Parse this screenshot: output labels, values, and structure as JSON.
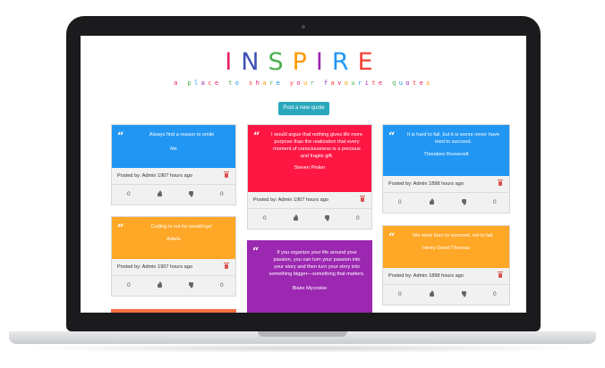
{
  "header": {
    "title_letters": [
      {
        "ch": "I",
        "color": "#e91e63"
      },
      {
        "ch": "N",
        "color": "#3f51b5"
      },
      {
        "ch": "S",
        "color": "#4caf50"
      },
      {
        "ch": "P",
        "color": "#ff9800"
      },
      {
        "ch": "I",
        "color": "#9c27b0"
      },
      {
        "ch": "R",
        "color": "#2196f3"
      },
      {
        "ch": "E",
        "color": "#f44336"
      }
    ],
    "tagline": "a place to share your favourite quotes",
    "tagline_colors": [
      "#e91e63",
      "#ff9800",
      "#4caf50",
      "#2196f3",
      "#9c27b0",
      "#f44336"
    ],
    "post_button": "Post a new quote"
  },
  "cards": [
    {
      "color": "#2196f3",
      "text": "Always find a reason to smile",
      "author": "Me",
      "posted": "Posted by: Admin 1907 hours ago",
      "up": "0",
      "down": "0"
    },
    {
      "color": "#ffa726",
      "text": "Coding is not for weaklings!",
      "author": "Adiela",
      "posted": "Posted by: Admin 1907 hours ago",
      "up": "0",
      "down": "0"
    },
    {
      "color": "#ff1744",
      "text": "I would argue that nothing gives life more purpose than the realization that every moment of consciousness is a precious and fragile gift.",
      "author": "Steven Pinker",
      "posted": "Posted by: Admin 1907 hours ago",
      "up": "0",
      "down": "0"
    },
    {
      "color": "#9c27b0",
      "text": "If you organize your life around your passion, you can turn your passion into your story and then turn your story into something bigger—something that matters.",
      "author": "Blake Mycoskie",
      "posted": "",
      "up": "",
      "down": ""
    },
    {
      "color": "#2196f3",
      "text": "It is hard to fail, but it is worse never have tried to succeed.",
      "author": "Theodore Roosevelt",
      "posted": "Posted by: Admin 1898 hours ago",
      "up": "0",
      "down": "0"
    },
    {
      "color": "#ffa726",
      "text": "We were born to succeed, not to fail.",
      "author": "Henry David Thoreau",
      "posted": "Posted by: Admin 1898 hours ago",
      "up": "0",
      "down": "0"
    }
  ],
  "partial_card_color": "#ff7043"
}
